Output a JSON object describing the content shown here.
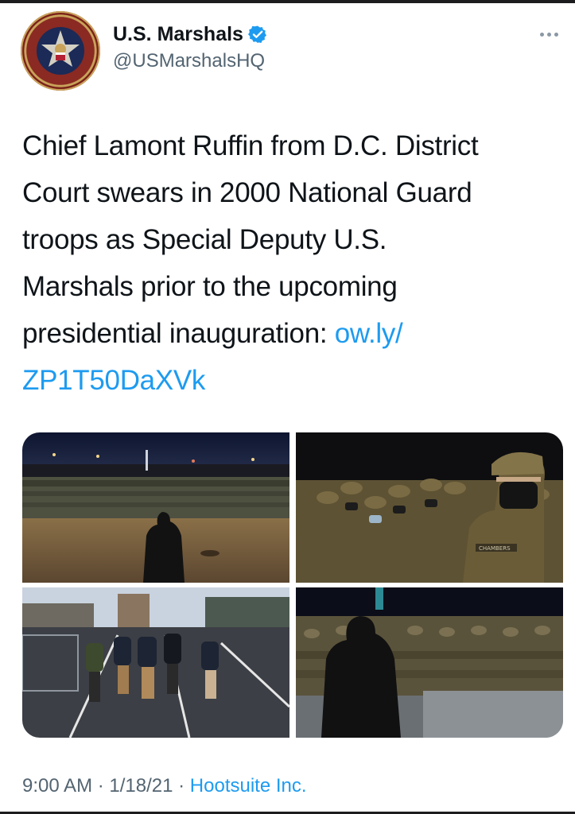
{
  "account": {
    "display_name": "U.S. Marshals",
    "handle": "@USMarshalsHQ",
    "verified": true,
    "avatar_icon": "us-marshals-seal-icon"
  },
  "tweet": {
    "lines": [
      "Chief Lamont Ruffin from D.C. District",
      "Court swears in 2000 National Guard",
      "troops as Special Deputy U.S.",
      "Marshals prior to the upcoming",
      "presidential inauguration: "
    ],
    "link_part1": "ow.ly/",
    "link_part2": "ZP1T50DaXVk"
  },
  "media": {
    "photos": [
      "night-plaza-troops-photo",
      "masked-soldiers-closeup-photo",
      "marshals-walking-street-photo",
      "troops-saluting-photo"
    ],
    "patch_text": "CHAMBERS"
  },
  "meta": {
    "time": "9:00 AM",
    "separator1": " · ",
    "date": "1/18/21",
    "separator2": " · ",
    "source": "Hootsuite Inc."
  },
  "colors": {
    "accent": "#1d9bf0",
    "text": "#0f1419",
    "secondary": "#536471"
  }
}
